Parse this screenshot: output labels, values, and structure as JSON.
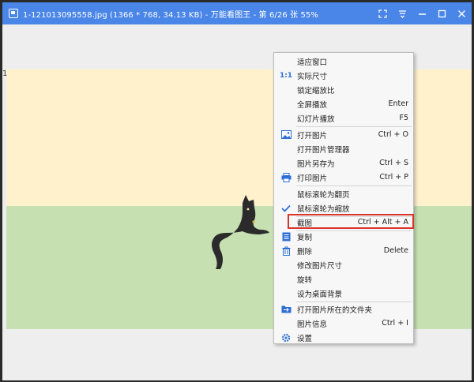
{
  "window": {
    "title": "1-121013095558.jpg  (1366 * 768, 34.13 KB) - 万能看图王 - 第 6/26 张 55%"
  },
  "viewer": {
    "left_digit": "1"
  },
  "context_menu": {
    "items": [
      {
        "label": "适应窗口",
        "shortcut": "",
        "icon": ""
      },
      {
        "label": "实际尺寸",
        "shortcut": "",
        "icon": "actual-size-icon",
        "icon_text": "1:1"
      },
      {
        "label": "锁定缩放比",
        "shortcut": "",
        "icon": ""
      },
      {
        "label": "全屏播放",
        "shortcut": "Enter",
        "icon": ""
      },
      {
        "label": "幻灯片播放",
        "shortcut": "F5",
        "icon": ""
      },
      {
        "label": "打开图片",
        "shortcut": "Ctrl + O",
        "icon": "picture-icon"
      },
      {
        "label": "打开图片管理器",
        "shortcut": "",
        "icon": ""
      },
      {
        "label": "图片另存为",
        "shortcut": "Ctrl + S",
        "icon": ""
      },
      {
        "label": "打印图片",
        "shortcut": "Ctrl + P",
        "icon": "printer-icon"
      },
      {
        "label": "鼠标滚轮为翻页",
        "shortcut": "",
        "icon": ""
      },
      {
        "label": "鼠标滚轮为缩放",
        "shortcut": "",
        "icon": "checkmark-icon"
      },
      {
        "label": "截图",
        "shortcut": "Ctrl + Alt + A",
        "icon": ""
      },
      {
        "label": "复制",
        "shortcut": "",
        "icon": "copy-icon"
      },
      {
        "label": "删除",
        "shortcut": "Delete",
        "icon": "trash-icon"
      },
      {
        "label": "修改图片尺寸",
        "shortcut": "",
        "icon": ""
      },
      {
        "label": "旋转",
        "shortcut": "",
        "icon": ""
      },
      {
        "label": "设为桌面背景",
        "shortcut": "",
        "icon": ""
      },
      {
        "label": "打开图片所在的文件夹",
        "shortcut": "",
        "icon": "folder-icon"
      },
      {
        "label": "图片信息",
        "shortcut": "Ctrl + I",
        "icon": ""
      },
      {
        "label": "设置",
        "shortcut": "",
        "icon": "gear-icon"
      }
    ]
  },
  "colors": {
    "titlebar": "#4a86e8",
    "highlight_border": "#d9342b",
    "icon_blue": "#2e6fd6"
  }
}
